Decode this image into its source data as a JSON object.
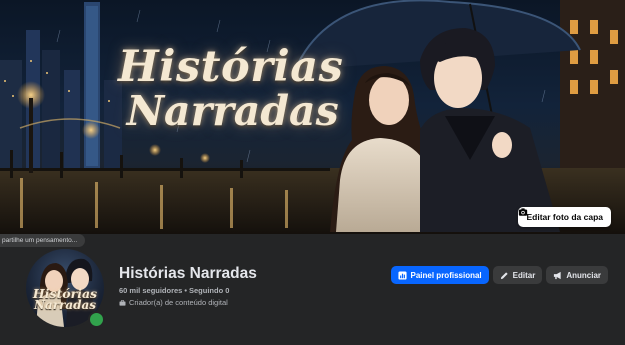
{
  "cover": {
    "title_line1": "Histórias",
    "title_line2": "Narradas",
    "edit_button_label": "Editar foto da capa",
    "edit_button_icon": "camera-icon"
  },
  "composer": {
    "placeholder_fragment": "partilhe um pensamento..."
  },
  "profile": {
    "name": "Histórias Narradas",
    "followers": "60 mil seguidores",
    "separator": "•",
    "following": "Seguindo 0",
    "category": "Criador(a) de conteúdo digital",
    "category_icon": "briefcase-icon",
    "avatar_text_line1": "Histórias",
    "avatar_text_line2": "Narradas",
    "online_status_color": "#31a24c"
  },
  "actions": {
    "professional_label": "Painel profissional",
    "professional_icon": "dashboard-icon",
    "edit_label": "Editar",
    "edit_icon": "pencil-icon",
    "advertise_label": "Anunciar",
    "advertise_icon": "megaphone-icon"
  },
  "colors": {
    "background": "#242526",
    "primary_button": "#0866ff",
    "secondary_button": "#3a3b3c",
    "text_primary": "#e4e6eb",
    "text_secondary": "#b0b3b8"
  }
}
